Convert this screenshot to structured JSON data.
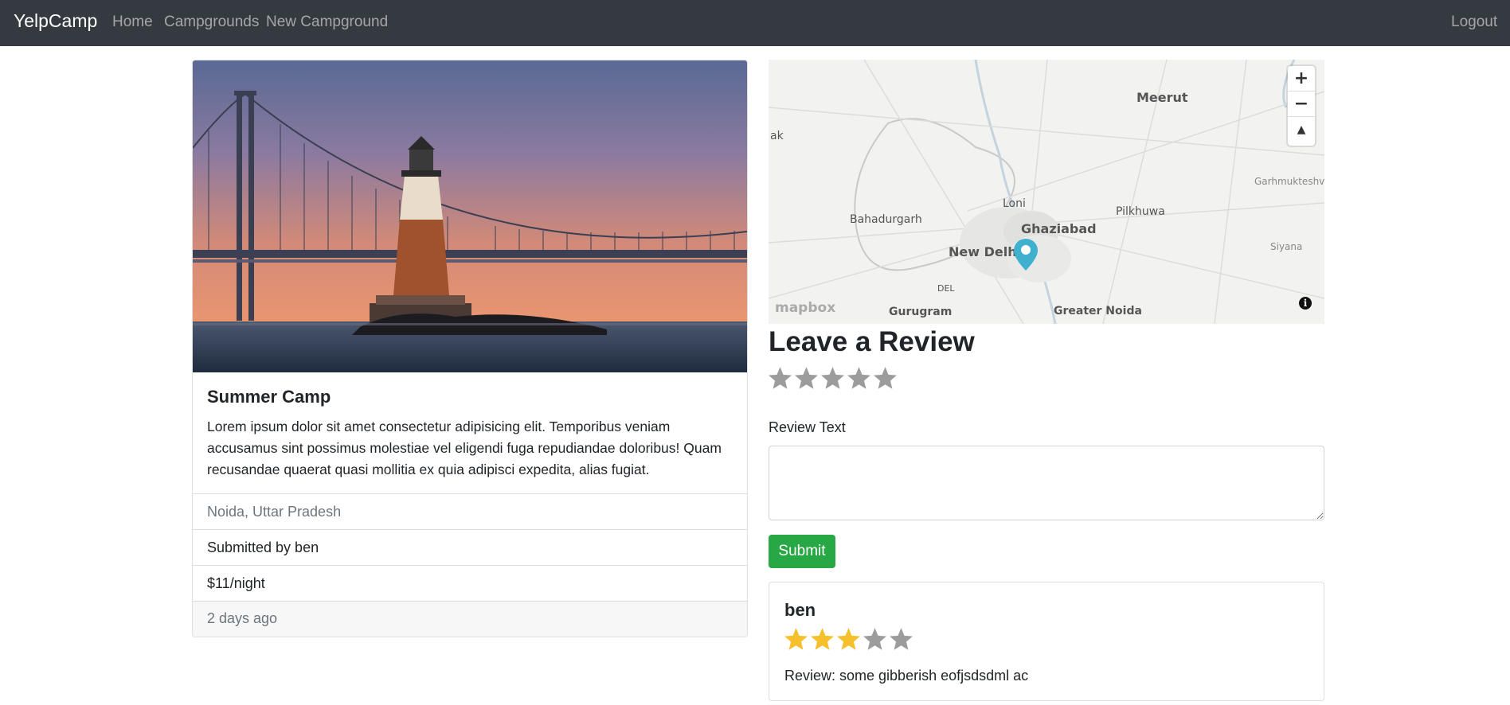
{
  "navbar": {
    "brand": "YelpCamp",
    "links": [
      "Home",
      "Campgrounds",
      "New Campground"
    ],
    "logout": "Logout"
  },
  "campground": {
    "image_alt": "Lighthouse in front of a suspension bridge at sunset",
    "title": "Summer Camp",
    "description": "Lorem ipsum dolor sit amet consectetur adipisicing elit. Temporibus veniam accusamus sint possimus molestiae vel eligendi fuga repudiandae doloribus! Quam recusandae quaerat quasi mollitia ex quia adipisci expedita, alias fugiat.",
    "location": "Noida, Uttar Pradesh",
    "submitted_by": "Submitted by ben",
    "price": "$11/night",
    "posted": "2 days ago"
  },
  "map": {
    "labels": [
      "Meerut",
      "ak",
      "Garhmukteshv",
      "Bahadurgarh",
      "Loni",
      "Pilkhuwa",
      "Ghaziabad",
      "New Delhi",
      "Siyana",
      "DEL",
      "Gurugram",
      "Greater Noida"
    ],
    "attribution": "mapbox",
    "zoom_in": "+",
    "zoom_out": "−",
    "compass": "▲",
    "marker_color": "#3fb1ce"
  },
  "review_form": {
    "heading": "Leave a Review",
    "rating": 0,
    "max_rating": 5,
    "text_label": "Review Text",
    "text_value": "",
    "submit_label": "Submit"
  },
  "reviews": [
    {
      "author": "ben",
      "rating": 3,
      "max_rating": 5,
      "text": "Review: some gibberish eofjsdsdml ac"
    }
  ],
  "colors": {
    "navbar_bg": "#343a40",
    "star_filled": "#f5c02b",
    "star_empty": "#9c9c9c",
    "submit_bg": "#28a745"
  }
}
